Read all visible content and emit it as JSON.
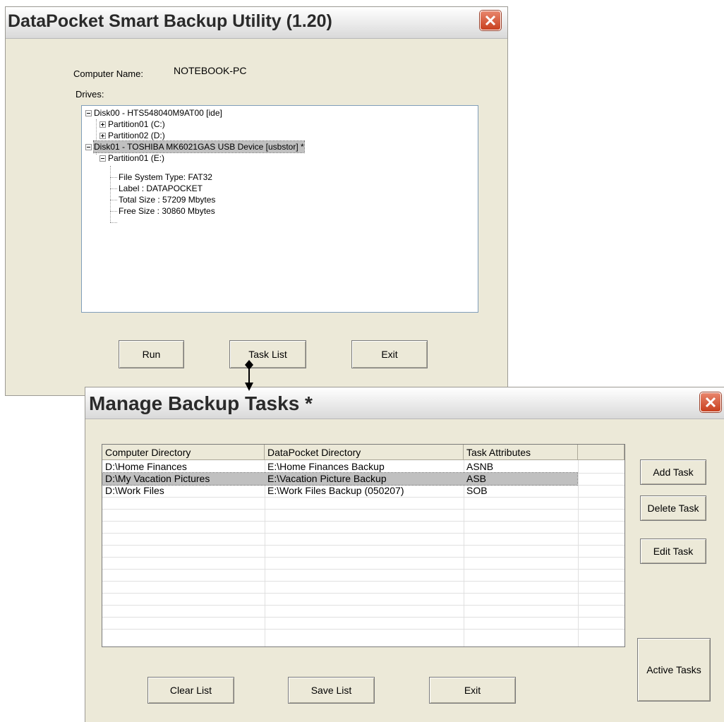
{
  "main_window": {
    "title": "DataPocket Smart Backup Utility (1.20)",
    "computer_name_label": "Computer Name:",
    "computer_name_value": "NOTEBOOK-PC",
    "drives_label": "Drives:",
    "tree": {
      "disk0": "Disk00 - HTS548040M9AT00 [ide]",
      "disk0_partition1": "Partition01 (C:)",
      "disk0_partition2": "Partition02 (D:)",
      "disk1": "Disk01 - TOSHIBA MK6021GAS USB Device [usbstor] *",
      "disk1_partition1": "Partition01 (E:)",
      "fs_type": "File System Type: FAT32",
      "label": "Label : DATAPOCKET",
      "total_size": "Total Size : 57209 Mbytes",
      "free_size": "Free Size : 30860 Mbytes"
    },
    "buttons": {
      "run": "Run",
      "task_list": "Task List",
      "exit": "Exit"
    }
  },
  "task_window": {
    "title": "Manage Backup Tasks *",
    "columns": [
      "Computer Directory",
      "DataPocket Directory",
      "Task Attributes",
      ""
    ],
    "rows": [
      [
        "D:\\Home Finances",
        "E:\\Home Finances Backup",
        "ASNB"
      ],
      [
        "D:\\My Vacation Pictures",
        "E:\\Vacation Picture Backup",
        "ASB"
      ],
      [
        "D:\\Work Files",
        "E:\\Work Files Backup (050207)",
        "SOB"
      ]
    ],
    "side_buttons": {
      "add_task": "Add Task",
      "delete_task": "Delete Task",
      "edit_task": "Edit Task",
      "active_tasks": "Active Tasks"
    },
    "bottom_buttons": {
      "clear_list": "Clear List",
      "save_list": "Save List",
      "exit": "Exit"
    }
  },
  "colors": {
    "window_bg": "#ece9d8",
    "close_button": "#c8401f",
    "selection": "#c0c0c0"
  }
}
